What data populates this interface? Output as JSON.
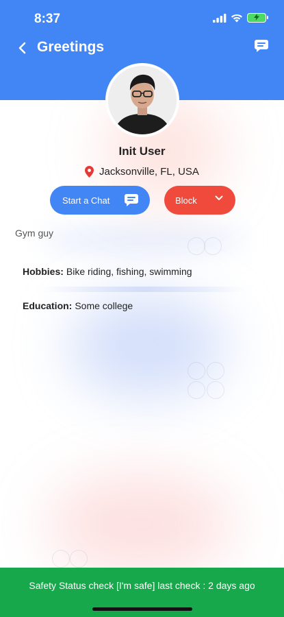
{
  "status_bar": {
    "time": "8:37",
    "icons": [
      "signal-icon",
      "wifi-icon",
      "battery-charging-icon"
    ]
  },
  "nav": {
    "back_icon": "chevron-left-icon",
    "title": "Greetings",
    "chat_icon": "chat-bubble-icon"
  },
  "profile": {
    "name": "Init User",
    "location": "Jacksonville, FL, USA",
    "location_icon": "map-pin-icon",
    "bio": "Gym guy"
  },
  "actions": {
    "start_chat_label": "Start a Chat",
    "block_label": "Block"
  },
  "details": {
    "hobbies_label": "Hobbies:",
    "hobbies_value": "Bike riding, fishing, swimming",
    "education_label": "Education:",
    "education_value": "Some college"
  },
  "safety": {
    "text": "Safety Status check [I'm safe] last check : 2 days ago"
  },
  "colors": {
    "header": "#4285f4",
    "start_chat": "#4285f4",
    "block": "#ef4a3c",
    "safety_bar": "#17a84b",
    "location_pin": "#e53935"
  }
}
